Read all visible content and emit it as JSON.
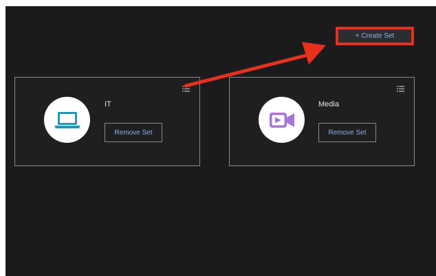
{
  "toolbar": {
    "create_label": "+ Create Set"
  },
  "sets": [
    {
      "title": "IT",
      "icon": "laptop-icon",
      "remove_label": "Remove Set"
    },
    {
      "title": "Media",
      "icon": "video-camera-icon",
      "remove_label": "Remove Set"
    }
  ],
  "colors": {
    "background": "#1b1b1d",
    "card_border": "#8a8a8a",
    "link_text": "#8fb0de",
    "highlight": "#e8301c",
    "laptop_icon": "#1f98b9",
    "video_icon": "#a974d6"
  }
}
